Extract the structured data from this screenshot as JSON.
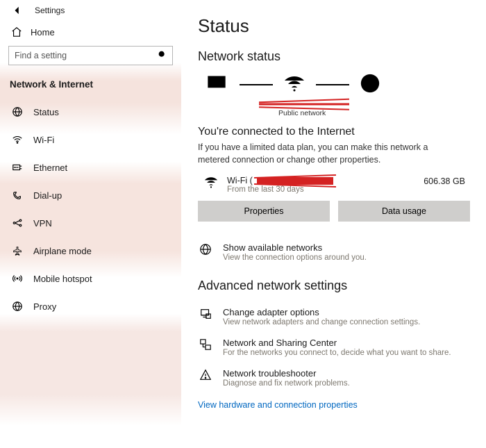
{
  "titlebar": {
    "title": "Settings"
  },
  "home": {
    "label": "Home"
  },
  "search": {
    "placeholder": "Find a setting"
  },
  "section": {
    "label": "Network & Internet"
  },
  "nav": {
    "items": [
      {
        "label": "Status"
      },
      {
        "label": "Wi-Fi"
      },
      {
        "label": "Ethernet"
      },
      {
        "label": "Dial-up"
      },
      {
        "label": "VPN"
      },
      {
        "label": "Airplane mode"
      },
      {
        "label": "Mobile hotspot"
      },
      {
        "label": "Proxy"
      }
    ]
  },
  "main": {
    "page_title": "Status",
    "network_status_heading": "Network status",
    "public_network_label": "Public network",
    "connected_heading": "You're connected to the Internet",
    "connected_desc": "If you have a limited data plan, you can make this network a metered connection or change other properties.",
    "conn_name_prefix": "Wi-Fi (",
    "conn_sub": "From the last 30 days",
    "data_amount": "606.38 GB",
    "properties_btn": "Properties",
    "data_usage_btn": "Data usage",
    "show_networks": {
      "title": "Show available networks",
      "sub": "View the connection options around you."
    },
    "advanced_heading": "Advanced network settings",
    "adapter": {
      "title": "Change adapter options",
      "sub": "View network adapters and change connection settings."
    },
    "sharing": {
      "title": "Network and Sharing Center",
      "sub": "For the networks you connect to, decide what you want to share."
    },
    "troubleshoot": {
      "title": "Network troubleshooter",
      "sub": "Diagnose and fix network problems."
    },
    "hw_link": "View hardware and connection properties"
  }
}
